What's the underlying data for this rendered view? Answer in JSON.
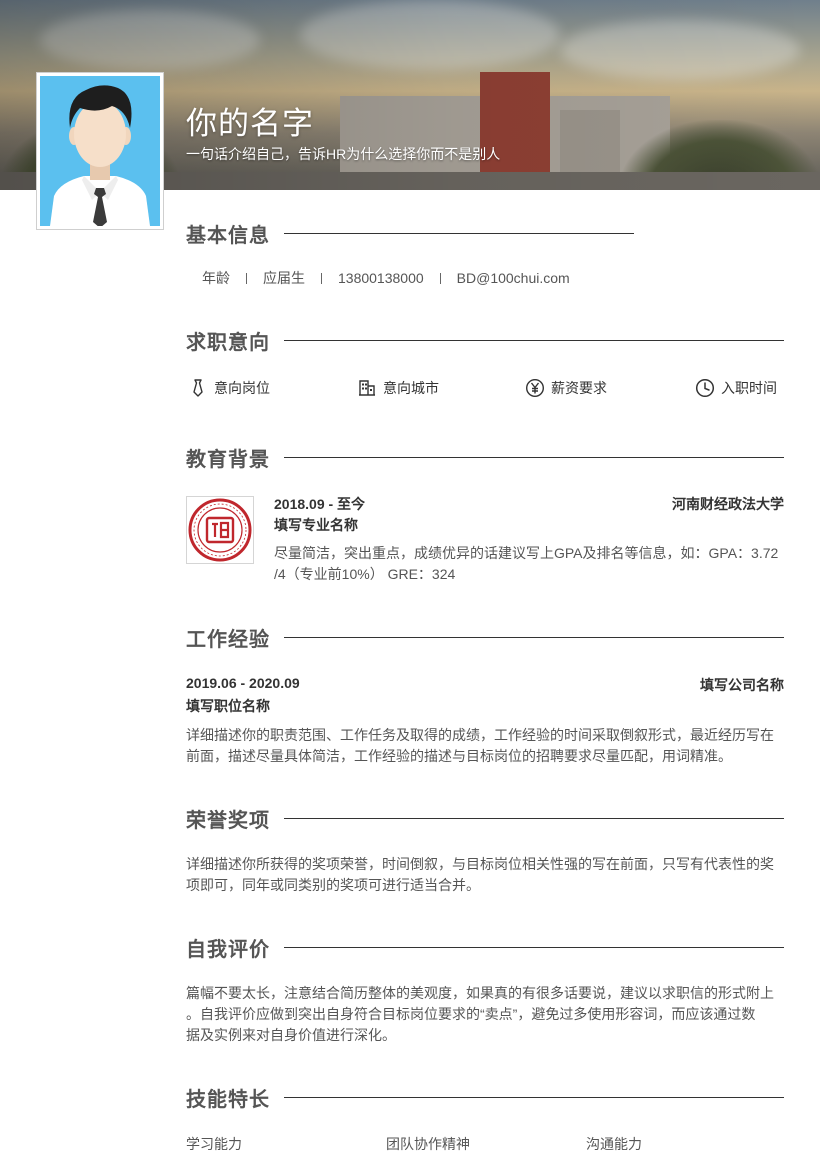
{
  "header": {
    "name": "你的名字",
    "tagline": "一句话介绍自己，告诉HR为什么选择你而不是别人"
  },
  "basic_info": {
    "title": "基本信息",
    "items": [
      "年龄",
      "应届生",
      "13800138000",
      "BD@100chui.com"
    ]
  },
  "intent": {
    "title": "求职意向",
    "items": [
      {
        "label": "意向岗位",
        "icon": "tie-icon"
      },
      {
        "label": "意向城市",
        "icon": "building-icon"
      },
      {
        "label": "薪资要求",
        "icon": "yen-icon"
      },
      {
        "label": "入职时间",
        "icon": "clock-icon"
      }
    ]
  },
  "education": {
    "title": "教育背景",
    "date": "2018.09 - 至今",
    "school": "河南财经政法大学",
    "major": "填写专业名称",
    "desc_line1": "尽量简洁，突出重点，成绩优异的话建议写上GPA及排名等信息，如：GPA：3.72",
    "desc_line2": "/4（专业前10%） GRE：324"
  },
  "work": {
    "title": "工作经验",
    "date": "2019.06 - 2020.09",
    "company": "填写公司名称",
    "position": "填写职位名称",
    "desc_line1": "详细描述你的职责范围、工作任务及取得的成绩，工作经验的时间采取倒叙形式，最近经历写在",
    "desc_line2": "前面，描述尽量具体简洁，工作经验的描述与目标岗位的招聘要求尽量匹配，用词精准。"
  },
  "honors": {
    "title": "荣誉奖项",
    "desc_line1": "详细描述你所获得的奖项荣誉，时间倒叙，与目标岗位相关性强的写在前面，只写有代表性的奖",
    "desc_line2": "项即可，同年或同类别的奖项可进行适当合并。"
  },
  "self_eval": {
    "title": "自我评价",
    "desc_line1": "篇幅不要太长，注意结合简历整体的美观度，如果真的有很多话要说，建议以求职信的形式附上",
    "desc_line2": "。自我评价应做到突出自身符合目标岗位要求的“卖点”，避免过多使用形容词，而应该通过数",
    "desc_line3": "据及实例来对自身价值进行深化。"
  },
  "skills": {
    "title": "技能特长",
    "items": [
      "学习能力",
      "团队协作精神",
      "沟通能力"
    ]
  },
  "colors": {
    "heading": "#555555",
    "text": "#555555",
    "avatar_bg": "#5bc0ef",
    "seal_red": "#c0272d"
  }
}
